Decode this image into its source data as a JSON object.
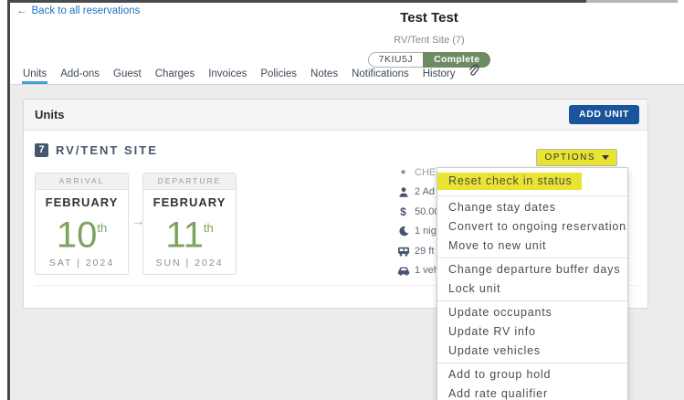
{
  "header": {
    "back_arrow_glyph": "←",
    "back_link": "Back to all reservations",
    "title": "Test Test",
    "subtitle": "RV/Tent Site (7)",
    "confirmation_code": "7KIU5J",
    "status": "Complete"
  },
  "tabs": [
    {
      "label": "Units",
      "active": true
    },
    {
      "label": "Add-ons"
    },
    {
      "label": "Guest"
    },
    {
      "label": "Charges"
    },
    {
      "label": "Invoices"
    },
    {
      "label": "Policies"
    },
    {
      "label": "Notes"
    },
    {
      "label": "Notifications"
    },
    {
      "label": "History"
    }
  ],
  "units_panel": {
    "title": "Units",
    "add_unit_label": "ADD UNIT",
    "unit": {
      "site_number": "7",
      "site_name": "RV/TENT SITE",
      "options_label": "OPTIONS",
      "arrival": {
        "label": "ARRIVAL",
        "month": "FEBRUARY",
        "day": "10",
        "ordinal": "th",
        "weekday_year": "SAT | 2024"
      },
      "arrow_glyph": "→",
      "departure": {
        "label": "DEPARTURE",
        "month": "FEBRUARY",
        "day": "11",
        "ordinal": "th",
        "weekday_year": "SUN | 2024"
      },
      "details": [
        {
          "icon": "status-dot-icon",
          "glyph": "●",
          "text": "CHE"
        },
        {
          "icon": "person-icon",
          "text": "2 Ad"
        },
        {
          "icon": "dollar-icon",
          "glyph": "$",
          "text": "50.00"
        },
        {
          "icon": "moon-icon",
          "text": "1 nigh"
        },
        {
          "icon": "rv-icon",
          "text": "29 ft"
        },
        {
          "icon": "car-icon",
          "text": "1 veh"
        }
      ]
    }
  },
  "options_menu": {
    "highlighted_item": "Reset check in status",
    "groups": [
      [
        "Reset check in status"
      ],
      [
        "Change stay dates",
        "Convert to ongoing reservation",
        "Move to new unit"
      ],
      [
        "Change departure buffer days",
        "Lock unit"
      ],
      [
        "Update occupants",
        "Update RV info",
        "Update vehicles"
      ],
      [
        "Add to group hold",
        "Add rate qualifier"
      ]
    ]
  },
  "colors": {
    "link_blue": "#1e73be",
    "active_tab_blue": "#41a0dc",
    "add_unit_blue": "#1a549c",
    "complete_green": "#6d8c63",
    "date_green": "#7aa35e",
    "slate": "#47566e",
    "highlight_yellow": "#e9e432",
    "page_bg": "#ececec"
  }
}
